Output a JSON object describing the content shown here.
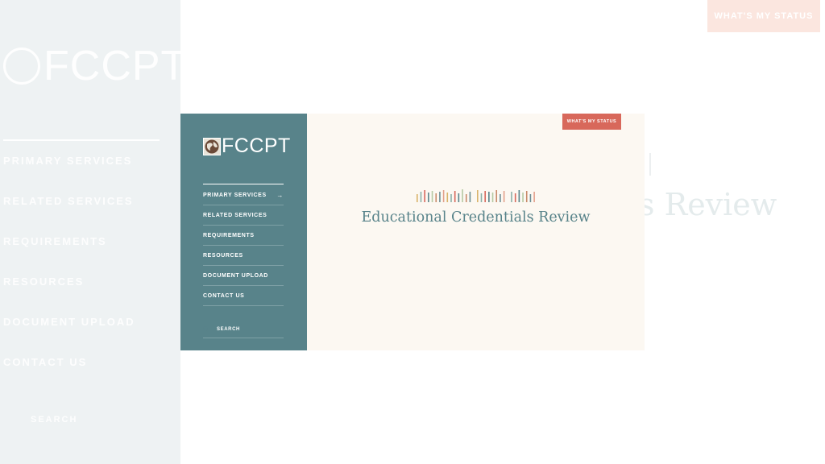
{
  "brand": {
    "name": "FCCPT"
  },
  "nav": {
    "items": [
      {
        "label": "PRIMARY SERVICES",
        "arrow": "→"
      },
      {
        "label": "RELATED SERVICES"
      },
      {
        "label": "REQUIREMENTS"
      },
      {
        "label": "RESOURCES"
      },
      {
        "label": "DOCUMENT UPLOAD"
      },
      {
        "label": "CONTACT US"
      }
    ],
    "search_label": "SEARCH"
  },
  "header": {
    "status_label": "WHAT'S MY STATUS"
  },
  "hero": {
    "title": "Educational Credentials Review"
  },
  "background": {
    "nav_items": [
      "PRIMARY SERVICES",
      "RELATED SERVICES",
      "REQUIREMENTS",
      "RESOURCES",
      "DOCUMENT UPLOAD",
      "CONTACT US"
    ],
    "search_label": "SEARCH",
    "status_label": "WHAT'S MY STATUS",
    "title_fragment": "s Review"
  },
  "colors": {
    "sidebar": "#58838a",
    "accent": "#d8685b",
    "content_bg": "#fcf8f2",
    "title": "#58838a"
  },
  "icons": {
    "logo": "globe-icon",
    "arrow": "arrow-right-icon",
    "search": "search-icon",
    "decoration": "color-bars-icon"
  }
}
